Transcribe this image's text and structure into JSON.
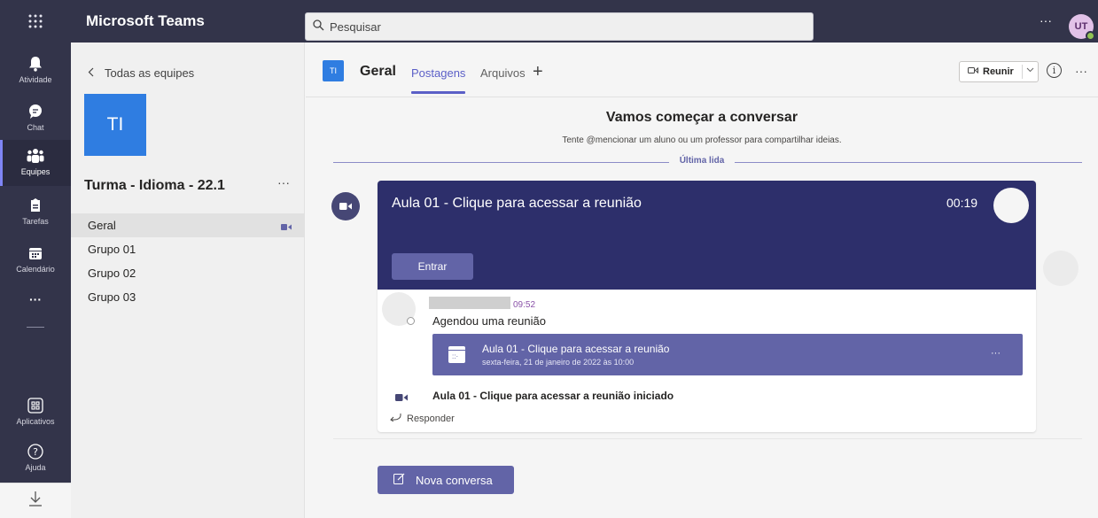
{
  "app": {
    "title": "Microsoft Teams"
  },
  "search": {
    "placeholder": "Pesquisar"
  },
  "user": {
    "initials": "UT",
    "presence_color": "#92c353"
  },
  "colors": {
    "rail": "#33344a",
    "accent": "#6264a7",
    "team_tile": "#2f7de1",
    "meeting_banner": "#2d2f6b"
  },
  "rail": {
    "items": [
      {
        "label": "Atividade",
        "icon": "bell-icon"
      },
      {
        "label": "Chat",
        "icon": "chat-icon"
      },
      {
        "label": "Equipes",
        "icon": "teams-icon"
      },
      {
        "label": "Tarefas",
        "icon": "assignments-icon"
      },
      {
        "label": "Calendário",
        "icon": "calendar-icon"
      },
      {
        "label": "Aplicativos",
        "icon": "apps-icon"
      },
      {
        "label": "Ajuda",
        "icon": "help-icon"
      }
    ],
    "more": "···"
  },
  "sidebar": {
    "back_label": "Todas as equipes",
    "team_initials": "TI",
    "team_name": "Turma - Idioma - 22.1",
    "more": "···",
    "channels": [
      "Geral",
      "Grupo 01",
      "Grupo 02",
      "Grupo 03"
    ]
  },
  "channel_header": {
    "initials": "TI",
    "name": "Geral",
    "tabs": [
      "Postagens",
      "Arquivos"
    ],
    "add_tab": "+",
    "meet_button": "Reunir",
    "info": "i",
    "more": "···"
  },
  "conversation": {
    "welcome_title": "Vamos começar a conversar",
    "welcome_sub": "Tente @mencionar um aluno ou um professor para compartilhar ideias.",
    "last_read": "Última lida",
    "meeting": {
      "title": "Aula 01 - Clique para acessar a reunião",
      "duration": "00:19",
      "join_label": "Entrar"
    },
    "post": {
      "time": "09:52",
      "text": "Agendou uma reunião",
      "event_title": "Aula 01 - Clique para acessar a reunião",
      "event_date": "sexta-feira, 21 de janeiro de 2022 às 10:00",
      "event_more": "···",
      "started_text": "Aula 01 - Clique para acessar a reunião iniciado",
      "reply_label": "Responder"
    },
    "new_conversation_label": "Nova conversa"
  }
}
